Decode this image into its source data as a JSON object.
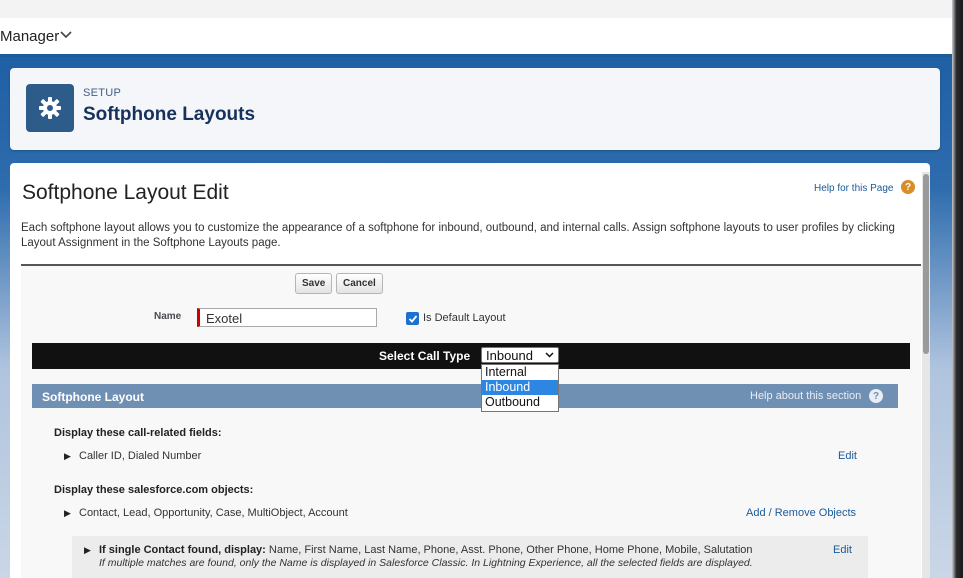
{
  "nav": {
    "app_name": "Manager",
    "chevron": "⌄"
  },
  "header": {
    "eyebrow": "SETUP",
    "title": "Softphone Layouts",
    "icon": "gear-icon"
  },
  "page": {
    "title": "Softphone Layout Edit",
    "help_link": "Help for this Page",
    "help_badge": "?",
    "description": "Each softphone layout allows you to customize the appearance of a softphone for inbound, outbound, and internal calls. Assign softphone layouts to user profiles by clicking Layout Assignment in the Softphone Layouts page."
  },
  "form": {
    "save_label": "Save",
    "cancel_label": "Cancel",
    "name_label": "Name",
    "name_value": "Exotel",
    "default_checked": true,
    "default_label": "Is Default Layout",
    "call_type_label": "Select Call Type",
    "call_type_selected": "Inbound",
    "call_type_options": [
      "Internal",
      "Inbound",
      "Outbound"
    ],
    "highlighted_option": "Inbound"
  },
  "section": {
    "title": "Softphone Layout",
    "help": "Help about this section",
    "help_icon": "?",
    "call_fields_heading": "Display these call-related fields:",
    "call_fields_value": "Caller ID, Dialed Number",
    "call_fields_edit": "Edit",
    "objects_heading": "Display these salesforce.com objects:",
    "objects_value": "Contact, Lead, Opportunity, Case, MultiObject, Account",
    "objects_link": "Add / Remove Objects",
    "contact_label": "If single Contact found, display:",
    "contact_fields": "Name, First Name, Last Name, Phone, Asst. Phone, Other Phone, Home Phone, Mobile, Salutation",
    "contact_edit": "Edit",
    "contact_note": "If multiple matches are found, only the Name is displayed in Salesforce Classic. In Lightning Experience, all the selected fields are displayed."
  },
  "colors": {
    "accent_blue": "#1a5a99",
    "setup_tile": "#2d5b8a",
    "section_header": "#6f8fb3",
    "selected_option": "#2c86e2",
    "required_marker": "#cc0000"
  }
}
